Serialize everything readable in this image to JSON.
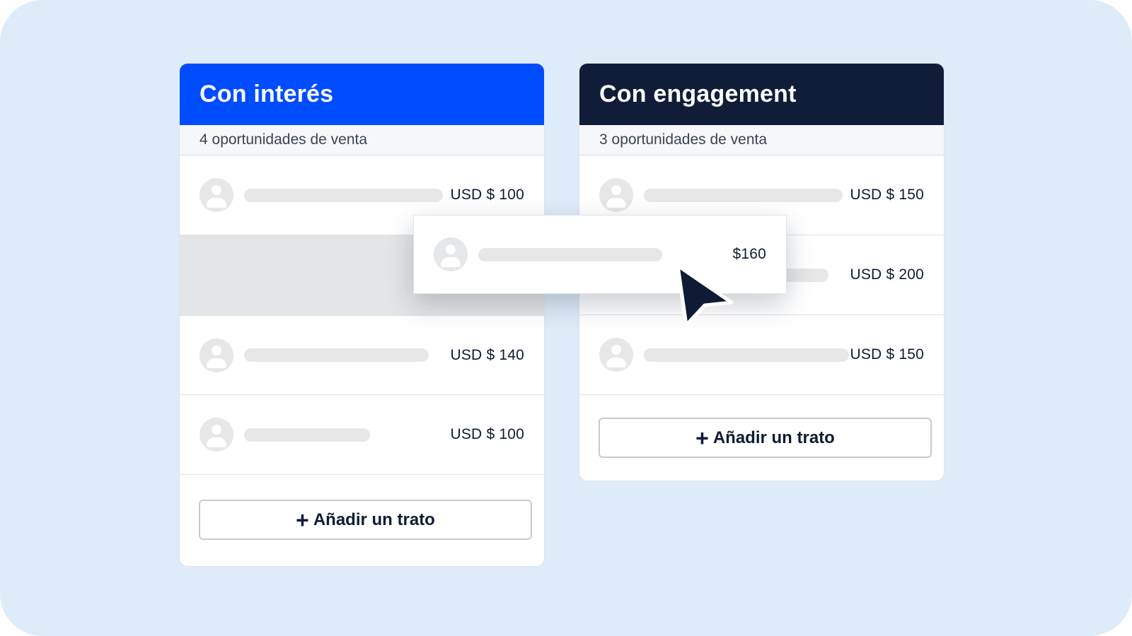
{
  "colors": {
    "background": "#deebf8",
    "header_interest": "#004cff",
    "header_engagement": "#0f1d38",
    "text_dark": "#0f1b34"
  },
  "columns": [
    {
      "title": "Con interés",
      "subtitle": "4 oportunidades de venta",
      "deals": [
        {
          "amount": "USD $ 100"
        },
        {
          "amount": ""
        },
        {
          "amount": "USD $ 140"
        },
        {
          "amount": "USD $ 100"
        }
      ],
      "add_label": "Añadir un trato"
    },
    {
      "title": "Con engagement",
      "subtitle": "3 oportunidades de venta",
      "deals": [
        {
          "amount": "USD $ 150"
        },
        {
          "amount": "USD $ 200"
        },
        {
          "amount": "USD $ 150"
        }
      ],
      "add_label": "Añadir un trato"
    }
  ],
  "dragging_card": {
    "amount": "$160"
  },
  "icons": {
    "avatar": "user-avatar-icon",
    "add": "plus-icon",
    "cursor": "mouse-pointer-icon"
  }
}
